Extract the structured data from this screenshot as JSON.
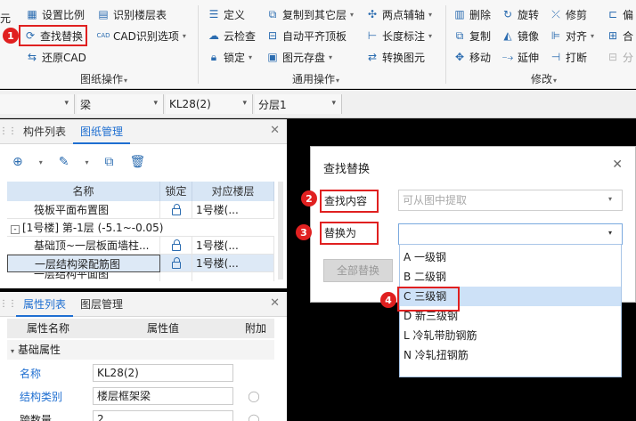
{
  "ribbon": {
    "group1": {
      "items": [
        "设置比例",
        "查找替换",
        "还原CAD"
      ],
      "items_b": [
        "识别楼层表",
        "CAD识别选项"
      ],
      "label": "图纸操作"
    },
    "group2": {
      "col1": [
        "定义",
        "云检查",
        "锁定"
      ],
      "col2": [
        "复制到其它层",
        "自动平齐顶板",
        "图元存盘"
      ],
      "col3": [
        "两点辅轴",
        "长度标注",
        "转换图元"
      ],
      "label": "通用操作"
    },
    "group3": {
      "col1": [
        "删除",
        "复制",
        "移动"
      ],
      "col2": [
        "旋转",
        "镜像",
        "延伸"
      ],
      "col3": [
        "修剪",
        "对齐",
        "打断"
      ],
      "col4": [
        "偏",
        "合",
        "分"
      ],
      "label": "修改"
    },
    "left_cut": "元"
  },
  "badges": [
    "1",
    "2",
    "3",
    "4"
  ],
  "combobar": {
    "c1": "梁",
    "c2": "KL28(2)",
    "c3": "分层1"
  },
  "drawing_panel": {
    "tabs": [
      "构件列表",
      "图纸管理"
    ],
    "columns": [
      "名称",
      "锁定",
      "对应楼层"
    ],
    "rows": [
      {
        "name": "筏板平面布置图",
        "floor": "1号楼(..."
      },
      {
        "name": "[1号楼] 第-1层 (-5.1~-0.05)",
        "floor": ""
      },
      {
        "name": "基础顶~一层板面墙柱...",
        "floor": "1号楼(..."
      },
      {
        "name": "一层结构梁配筋图",
        "floor": "1号楼(..."
      },
      {
        "name": "一层结构平面图",
        "floor": ""
      }
    ],
    "tree_toggle": "-"
  },
  "prop_panel": {
    "tabs": [
      "属性列表",
      "图层管理"
    ],
    "columns": [
      "属性名称",
      "属性值",
      "附加"
    ],
    "section": "基础属性",
    "rows": [
      {
        "name": "名称",
        "value": "KL28(2)"
      },
      {
        "name": "结构类别",
        "value": "楼层框架梁"
      },
      {
        "name": "跨数量",
        "value": "2"
      }
    ]
  },
  "dialog": {
    "title": "查找替换",
    "find_label": "查找内容",
    "find_placeholder": "可从图中提取",
    "replace_label": "替换为",
    "replace_all": "全部替换"
  },
  "options": [
    "A 一级钢",
    "B 二级钢",
    "C 三级钢",
    "D 新三级钢",
    "L 冷轧带肋钢筋",
    "N 冷轧扭钢筋"
  ],
  "colors": {
    "accent": "#1f6fd1",
    "highlight": "#e02020",
    "selected": "#cde1f7"
  }
}
